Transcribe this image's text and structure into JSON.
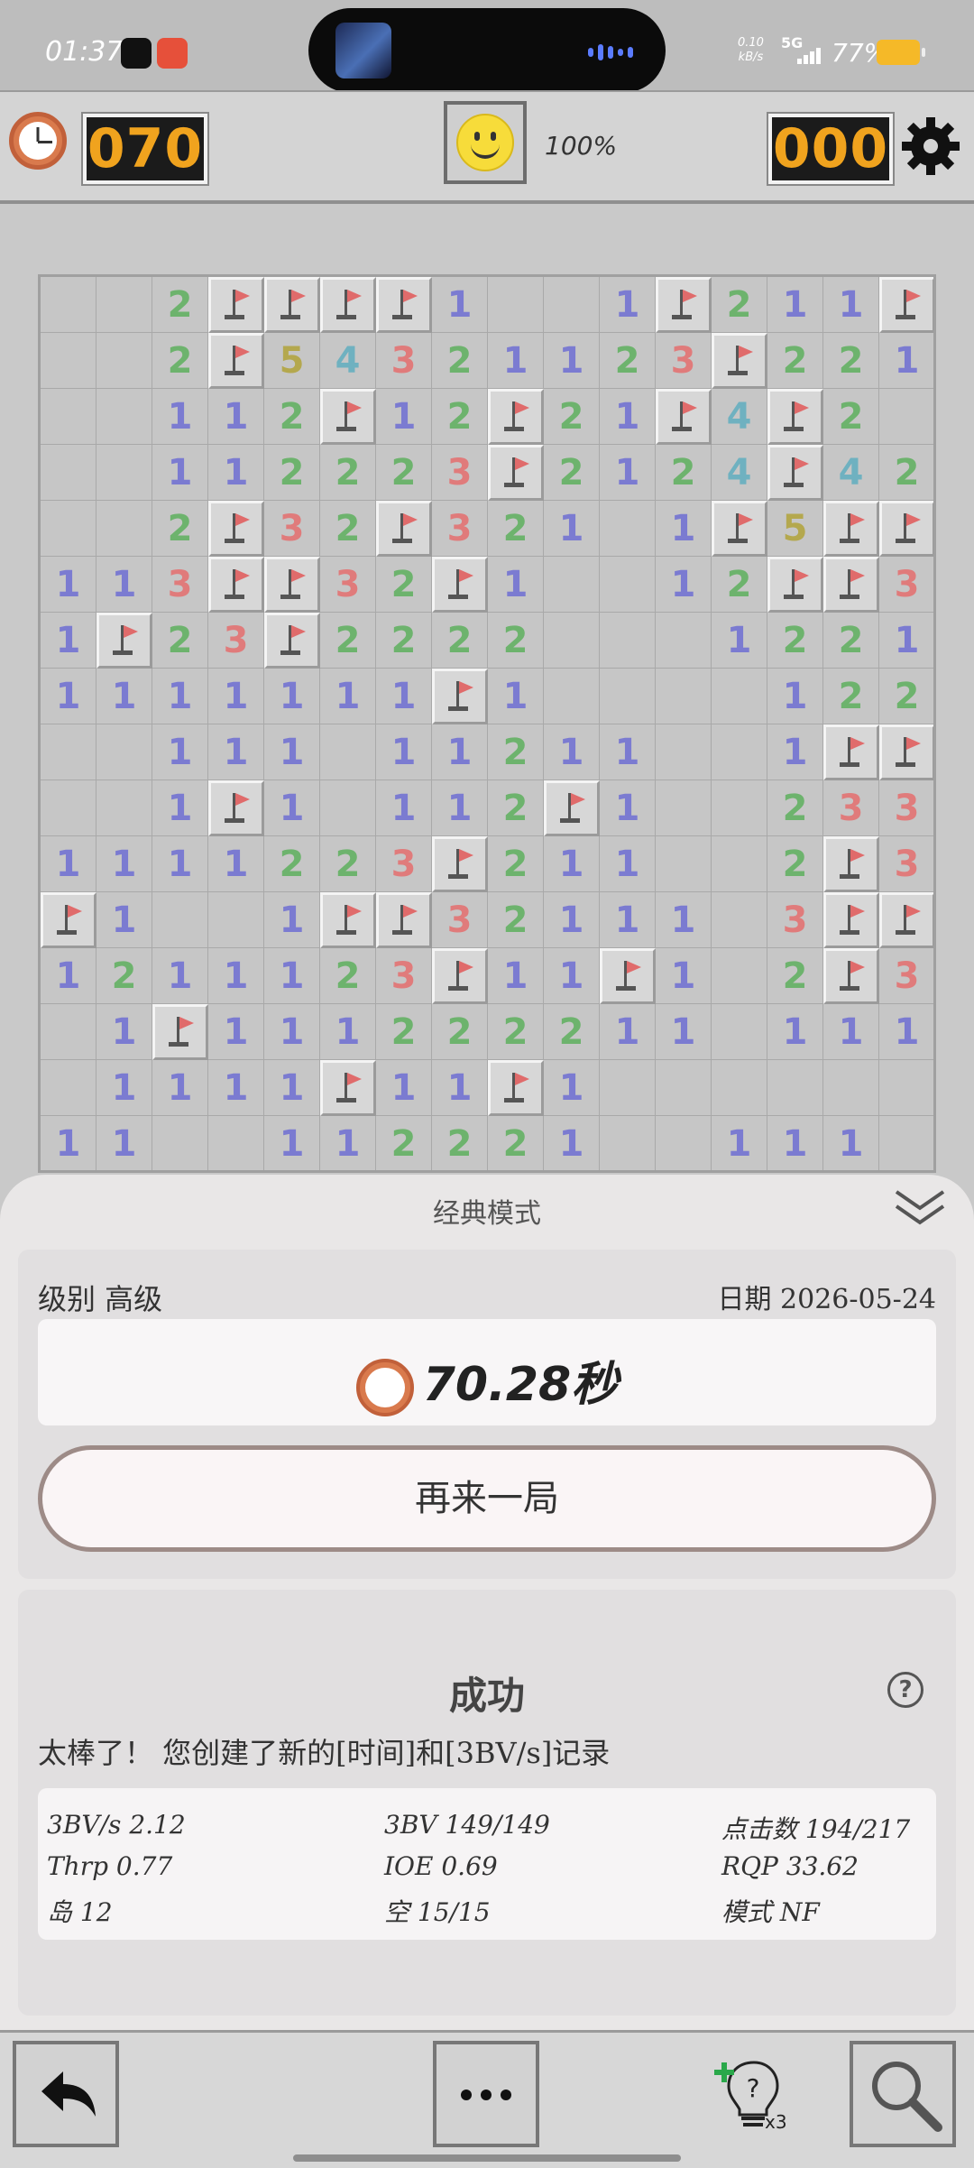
{
  "status_bar": {
    "time": "01:37",
    "net_speed_value": "0.10",
    "net_speed_unit": "kB/s",
    "network": "5G",
    "battery": "77%"
  },
  "game_header": {
    "timer_value": "070",
    "progress": "100%",
    "mines_value": "000"
  },
  "board": {
    "rows": [
      [
        "",
        "",
        "2",
        "F",
        "F",
        "F",
        "F",
        "1",
        "",
        "",
        "1",
        "F",
        "2",
        "1",
        "1",
        "F"
      ],
      [
        "",
        "",
        "2",
        "F",
        "5",
        "4",
        "3",
        "2",
        "1",
        "1",
        "2",
        "3",
        "F",
        "2",
        "2",
        "1"
      ],
      [
        "",
        "",
        "1",
        "1",
        "2",
        "F",
        "1",
        "2",
        "F",
        "2",
        "1",
        "F",
        "4",
        "F",
        "2",
        ""
      ],
      [
        "",
        "",
        "1",
        "1",
        "2",
        "2",
        "2",
        "3",
        "F",
        "2",
        "1",
        "2",
        "4",
        "F",
        "4",
        "2"
      ],
      [
        "",
        "",
        "2",
        "F",
        "3",
        "2",
        "F",
        "3",
        "2",
        "1",
        "",
        "1",
        "F",
        "5",
        "F",
        "F"
      ],
      [
        "1",
        "1",
        "3",
        "F",
        "F",
        "3",
        "2",
        "F",
        "1",
        "",
        "",
        "1",
        "2",
        "F",
        "F",
        "3"
      ],
      [
        "1",
        "F",
        "2",
        "3",
        "F",
        "2",
        "2",
        "2",
        "2",
        "",
        "",
        "",
        "1",
        "2",
        "2",
        "1"
      ],
      [
        "1",
        "1",
        "1",
        "1",
        "1",
        "1",
        "1",
        "F",
        "1",
        "",
        "",
        "",
        "",
        "1",
        "2",
        "2"
      ],
      [
        "",
        "",
        "1",
        "1",
        "1",
        "",
        "1",
        "1",
        "2",
        "1",
        "1",
        "",
        "",
        "1",
        "F",
        "F"
      ],
      [
        "",
        "",
        "1",
        "F",
        "1",
        "",
        "1",
        "1",
        "2",
        "F",
        "1",
        "",
        "",
        "2",
        "3",
        "3"
      ],
      [
        "1",
        "1",
        "1",
        "1",
        "2",
        "2",
        "3",
        "F",
        "2",
        "1",
        "1",
        "",
        "",
        "2",
        "F",
        "3"
      ],
      [
        "F",
        "1",
        "",
        "",
        "1",
        "F",
        "F",
        "3",
        "2",
        "1",
        "1",
        "1",
        "",
        "3",
        "F",
        "F"
      ],
      [
        "1",
        "2",
        "1",
        "1",
        "1",
        "2",
        "3",
        "F",
        "1",
        "1",
        "F",
        "1",
        "",
        "2",
        "F",
        "3"
      ],
      [
        "",
        "1",
        "F",
        "1",
        "1",
        "1",
        "2",
        "2",
        "2",
        "2",
        "1",
        "1",
        "",
        "1",
        "1",
        "1"
      ],
      [
        "",
        "1",
        "1",
        "1",
        "1",
        "F",
        "1",
        "1",
        "F",
        "1",
        "",
        "",
        "",
        "",
        "",
        ""
      ],
      [
        "1",
        "1",
        "",
        "",
        "1",
        "1",
        "2",
        "2",
        "2",
        "1",
        "",
        "",
        "1",
        "1",
        "1",
        ""
      ]
    ],
    "number_colors": {
      "1": "#7b7bd1",
      "2": "#6db36d",
      "3": "#e07b7b",
      "4": "#6fb1c0",
      "5": "#b4a84e"
    }
  },
  "result_sheet": {
    "title": "经典模式",
    "level_text": "级别 高级",
    "date_text": "日期 2026-05-24",
    "time_result": "70.28秒",
    "play_again_label": "再来一局",
    "success_title": "成功",
    "help_symbol": "?",
    "message": "太棒了！ 您创建了新的[时间]和[3BV/s]记录",
    "stats": [
      [
        "3BV/s 2.12",
        "3BV 149/149",
        "点击数 194/217"
      ],
      [
        "Thrp 0.77",
        "IOE 0.69",
        "RQP 33.62"
      ],
      [
        "岛 12",
        "空 15/15",
        "模式 NF"
      ]
    ]
  },
  "toolbar": {
    "hint_count": "x3"
  },
  "colors": {
    "counter_digits": "#f0a31e",
    "flag": "#e06b6b",
    "battery": "#f5b928"
  }
}
